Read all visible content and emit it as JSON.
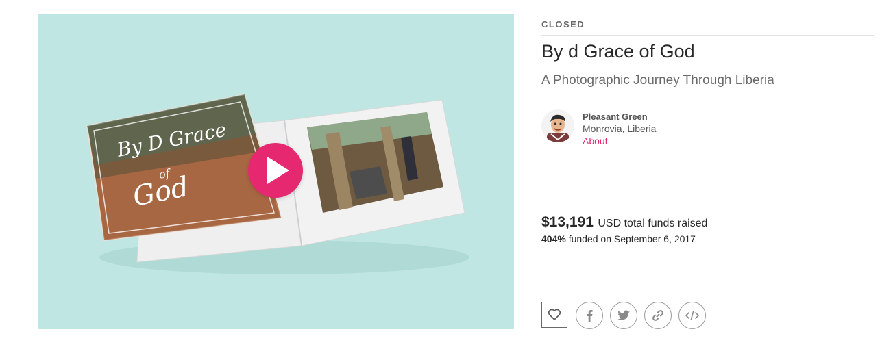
{
  "campaign": {
    "status": "CLOSED",
    "title": "By d Grace of God",
    "tagline": "A Photographic Journey Through Liberia",
    "video_title_art": [
      "By D Grace",
      "of",
      "God"
    ],
    "accent_color": "#e5286f"
  },
  "owner": {
    "name": "Pleasant Green",
    "location": "Monrovia, Liberia",
    "about_link": "About"
  },
  "funding": {
    "amount": "$13,191",
    "amount_label": "USD total funds raised",
    "percent": "404%",
    "funded_text": "funded on September 6, 2017"
  },
  "share": {
    "icons": [
      "heart-icon",
      "facebook-icon",
      "twitter-icon",
      "link-icon",
      "embed-icon"
    ]
  }
}
